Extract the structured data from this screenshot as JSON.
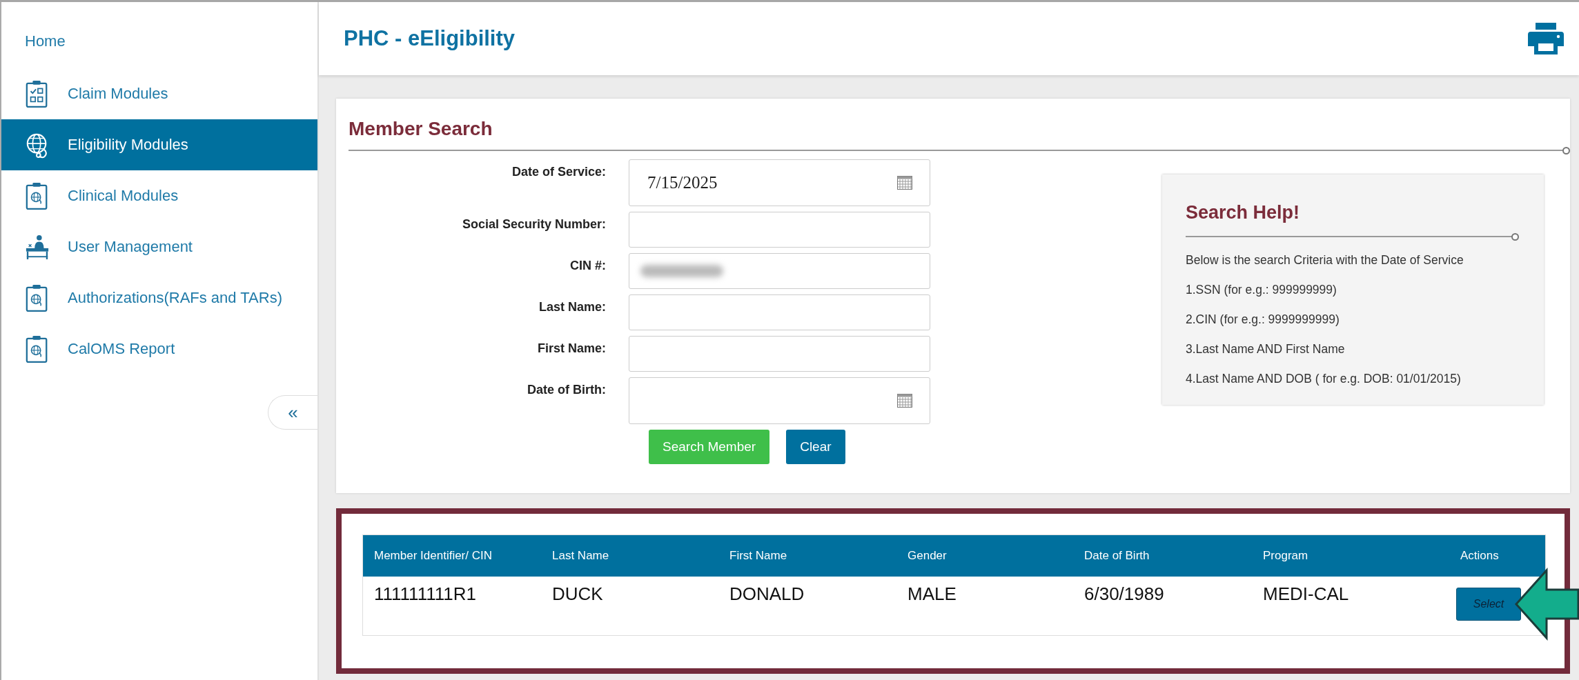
{
  "sidebar": {
    "items": [
      {
        "label": "Home",
        "kind": "link",
        "selected": false
      },
      {
        "label": "Claim Modules",
        "kind": "checklist",
        "selected": false
      },
      {
        "label": "Eligibility Modules",
        "kind": "globe",
        "selected": true
      },
      {
        "label": "Clinical Modules",
        "kind": "clipboard",
        "selected": false
      },
      {
        "label": "User Management",
        "kind": "desk",
        "selected": false
      },
      {
        "label": "Authorizations(RAFs and TARs)",
        "kind": "clipboard",
        "selected": false
      },
      {
        "label": "CalOMS Report",
        "kind": "clipboard",
        "selected": false
      }
    ],
    "collapse": "«"
  },
  "header": {
    "title": "PHC - eEligibility"
  },
  "member_search": {
    "title": "Member Search",
    "fields": [
      {
        "label": "Date of Service:",
        "kind": "date",
        "value": "7/15/2025"
      },
      {
        "label": "Social Security Number:",
        "kind": "text"
      },
      {
        "label": "CIN #:",
        "kind": "text",
        "blurred": true
      },
      {
        "label": "Last Name:",
        "kind": "text"
      },
      {
        "label": "First Name:",
        "kind": "text"
      },
      {
        "label": "Date of Birth:",
        "kind": "date"
      }
    ],
    "buttons": [
      {
        "label": "Search Member",
        "kind": "primary"
      },
      {
        "label": "Clear",
        "kind": "secondary"
      }
    ]
  },
  "search_help": {
    "title": "Search Help!",
    "lines": [
      "Below is the search Criteria with the Date of Service",
      "1.SSN (for e.g.: 999999999)",
      "2.CIN (for e.g.: 9999999999)",
      "3.Last Name AND First Name",
      "4.Last Name AND DOB ( for e.g. DOB: 01/01/2015)"
    ]
  },
  "results": {
    "columns": [
      "Member Identifier/ CIN",
      "Last Name",
      "First Name",
      "Gender",
      "Date of Birth",
      "Program",
      "Actions"
    ],
    "rows": [
      {
        "cells": [
          "111111111R1",
          "DUCK",
          "DONALD",
          "MALE",
          "6/30/1989",
          "MEDI-CAL"
        ],
        "action": "Select"
      }
    ],
    "highlighted": true
  }
}
